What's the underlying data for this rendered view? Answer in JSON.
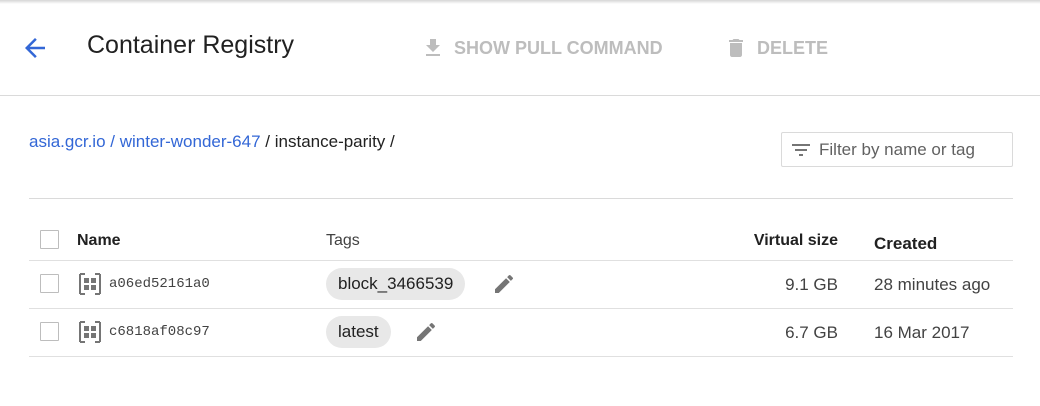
{
  "header": {
    "title": "Container Registry",
    "actions": [
      {
        "label": "SHOW PULL COMMAND",
        "icon": "download-icon",
        "enabled": false
      },
      {
        "label": "DELETE",
        "icon": "trash-icon",
        "enabled": false
      }
    ]
  },
  "breadcrumb": {
    "items": [
      {
        "label": "asia.gcr.io",
        "link": true
      },
      {
        "label": "winter-wonder-647",
        "link": true
      },
      {
        "label": "instance-parity",
        "link": false
      }
    ],
    "separator": "/"
  },
  "filter": {
    "placeholder": "Filter by name or tag",
    "icon": "filter-list-icon"
  },
  "table": {
    "columns": {
      "name": "Name",
      "tags": "Tags",
      "virtual_size": "Virtual size",
      "created": "Created"
    },
    "rows": [
      {
        "name": "a06ed52161a0",
        "tag": "block_3466539",
        "virtual_size": "9.1 GB",
        "created": "28 minutes ago"
      },
      {
        "name": "c6818af08c97",
        "tag": "latest",
        "virtual_size": "6.7 GB",
        "created": "16 Mar 2017"
      }
    ]
  },
  "colors": {
    "link": "#3367d6",
    "disabled_action": "#bdbdbd",
    "chip_bg": "#e8e8e8"
  }
}
